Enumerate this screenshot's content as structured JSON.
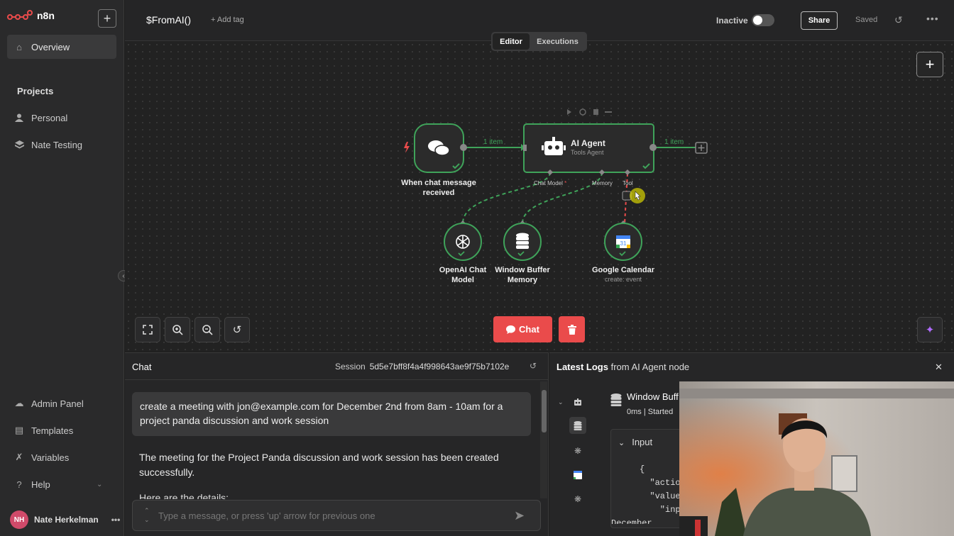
{
  "app": {
    "name": "n8n",
    "accent": "#ea4b4b"
  },
  "sidebar": {
    "overview": "Overview",
    "projects_heading": "Projects",
    "projects": [
      "Personal",
      "Nate Testing"
    ],
    "bottom": [
      "Admin Panel",
      "Templates",
      "Variables",
      "Help"
    ],
    "user": {
      "initials": "NH",
      "name": "Nate Herkelman"
    }
  },
  "header": {
    "title": "$FromAI()",
    "add_tag": "+ Add tag",
    "status": "Inactive",
    "share": "Share",
    "saved": "Saved"
  },
  "tabs": [
    "Editor",
    "Executions"
  ],
  "nodes": {
    "trigger": {
      "label": "When chat message received"
    },
    "agent": {
      "title": "AI Agent",
      "subtitle": "Tools Agent"
    },
    "openai": {
      "label": "OpenAI Chat Model"
    },
    "memory": {
      "label": "Window Buffer Memory"
    },
    "calendar": {
      "label": "Google Calendar",
      "sub": "create: event"
    },
    "ports": {
      "chat_model": "Chat Model",
      "required_mark": "*",
      "memory": "Memory",
      "tool": "Tool"
    },
    "edges": {
      "left_count": "1 item",
      "right_count": "1 item"
    },
    "calendar_day": "31"
  },
  "controls": {
    "chat_button": "Chat"
  },
  "chat": {
    "title": "Chat",
    "session_label": "Session",
    "session_id": "5d5e7bff8f4a4f998643ae9f75b7102e",
    "user_message": "create a meeting with jon@example.com for December 2nd from 8am - 10am for a project panda discussion and work session",
    "bot_message": "The meeting for the Project Panda discussion and work session has been created successfully.",
    "bot_message_2": "Here are the details:",
    "input_placeholder": "Type a message, or press 'up' arrow for previous one"
  },
  "logs": {
    "title_bold": "Latest Logs",
    "title_rest": " from AI Agent node",
    "node_name": "Window Buff",
    "time": "0ms | Started",
    "input_label": "Input",
    "code_lines": [
      "{",
      "  \"actio",
      "  \"value",
      "    \"inp",
      "December"
    ]
  }
}
